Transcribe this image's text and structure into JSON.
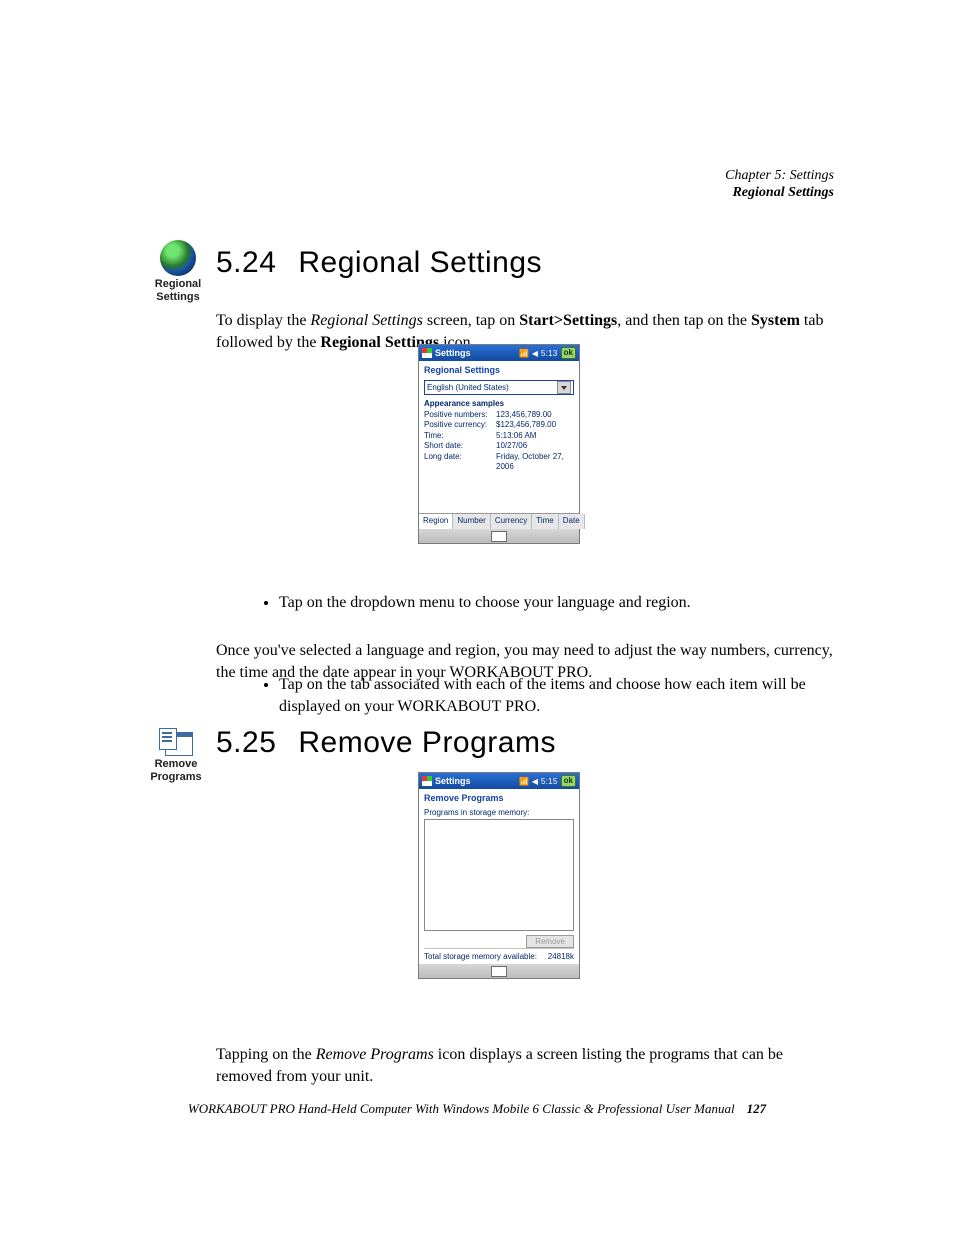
{
  "header": {
    "line1": "Chapter  5:  Settings",
    "line2": "Regional Settings"
  },
  "icon1_label_l1": "Regional",
  "icon1_label_l2": "Settings",
  "s524": {
    "num": "5.24",
    "title": "Regional Settings",
    "p1_a": "To display the ",
    "p1_i": "Regional Settings",
    "p1_b": " screen, tap on ",
    "p1_bold1": "Start>Settings",
    "p1_c": ", and then tap on the ",
    "p1_bold2": "System",
    "p1_d": " tab followed by the ",
    "p1_bold3": "Regional Settings",
    "p1_e": " icon.",
    "bullet1": "Tap on the dropdown menu to choose your language and region.",
    "p2": "Once you've selected a language and region, you may need to adjust the way numbers, currency, the time and the date appear in your WORKABOUT PRO.",
    "bullet2": "Tap on the tab associated with each of the items and choose how each item will be displayed on your WORKABOUT PRO."
  },
  "dev1": {
    "title": "Settings",
    "status": "◀ 5:13",
    "ok": "ok",
    "sub": "Regional Settings",
    "select": "English (United States)",
    "section": "Appearance samples",
    "rows": [
      {
        "k": "Positive numbers:",
        "v": "123,456,789.00"
      },
      {
        "k": "Positive currency:",
        "v": "$123,456,789.00"
      },
      {
        "k": "Time:",
        "v": "5:13:06 AM"
      },
      {
        "k": "Short date:",
        "v": "10/27/06"
      },
      {
        "k": "Long date:",
        "v": "Friday, October 27, 2006"
      }
    ],
    "tabs": [
      "Region",
      "Number",
      "Currency",
      "Time",
      "Date"
    ]
  },
  "icon2_label_l1": "Remove",
  "icon2_label_l2": "Programs",
  "s525": {
    "num": "5.25",
    "title": "Remove Programs",
    "p1_a": "Tapping on the ",
    "p1_i": "Remove Programs",
    "p1_b": " icon displays a screen listing the programs that can be removed from your unit."
  },
  "dev2": {
    "title": "Settings",
    "status": "◀ 5:15",
    "ok": "ok",
    "sub": "Remove Programs",
    "line": "Programs in storage memory:",
    "btn": "Remove",
    "mem_label": "Total storage memory available:",
    "mem_val": "24818k"
  },
  "footer": {
    "text": "WORKABOUT PRO Hand-Held Computer With Windows Mobile 6 Classic & Professional User Manual",
    "page": "127"
  }
}
